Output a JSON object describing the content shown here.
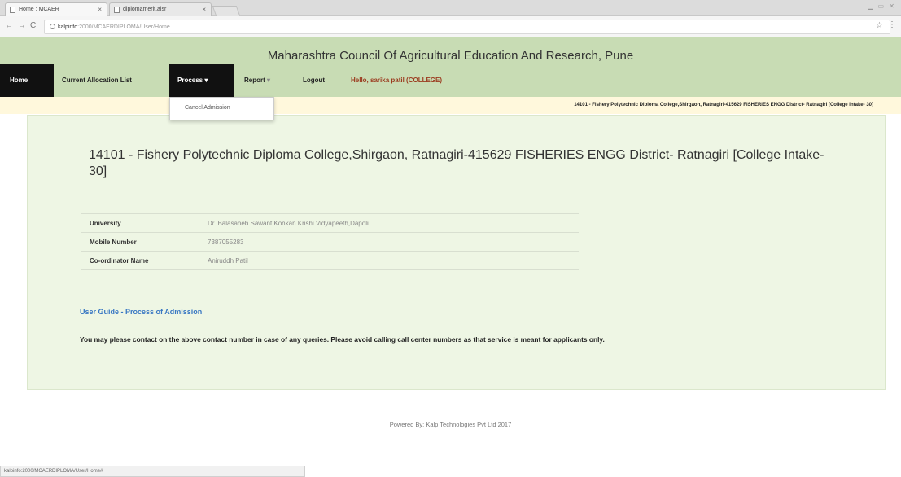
{
  "browser": {
    "tabs": [
      {
        "title": "Home : MCAER",
        "close": "×"
      },
      {
        "title": "diplomamerit.aisr",
        "close": "×"
      }
    ],
    "window_controls": "▁ ▭ ✕",
    "url_host": "kalpinfo",
    "url_rest": ":2000/MCAERDIPLOMA/User/Home",
    "status_url": "kalpinfo:2000/MCAERDIPLOMA/User/Home#"
  },
  "header": {
    "title": "Maharashtra Council Of Agricultural Education And Research, Pune"
  },
  "nav": {
    "home": "Home",
    "current_allocation": "Current Allocation List",
    "process": "Process",
    "process_caret": "▾",
    "report": "Report",
    "report_caret": "▾",
    "logout": "Logout",
    "hello": "Hello, sarika patil  (COLLEGE)"
  },
  "dropdown": {
    "items": [
      "Cancel Admission"
    ]
  },
  "info_strip": "14101 - Fishery Polytechnic Diploma College,Shirgaon, Ratnagiri-415629 FISHERIES ENGG District- Ratnagiri [College Intake- 30]",
  "main": {
    "heading": "14101 - Fishery Polytechnic Diploma College,Shirgaon, Ratnagiri-415629 FISHERIES ENGG District- Ratnagiri [College Intake- 30]",
    "rows": [
      {
        "label": "University",
        "value": "Dr. Balasaheb Sawant Konkan Krishi Vidyapeeth,Dapoli"
      },
      {
        "label": "Mobile Number",
        "value": "7387055283"
      },
      {
        "label": "Co-ordinator Name",
        "value": "Aniruddh Patil"
      }
    ],
    "guide_link": "User Guide - Process of Admission",
    "notice": "You may please contact on the above contact number in case of any queries. Please avoid calling call center numbers as that service is meant for applicants only."
  },
  "footer": "Powered By: Kalp Technologies Pvt Ltd 2017"
}
